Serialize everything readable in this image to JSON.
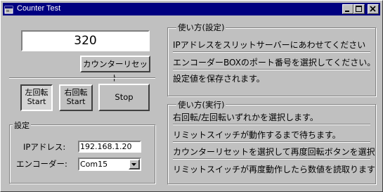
{
  "window": {
    "title": "Counter Test",
    "app_icon": "app-icon",
    "controls": {
      "minimize": "minimize-icon",
      "maximize": "maximize-icon",
      "close": "close-icon"
    }
  },
  "counter": {
    "value": "320"
  },
  "buttons": {
    "reset": "カウンターリセット",
    "left_top": "左回転",
    "left_bottom": "Start",
    "right_top": "右回転",
    "right_bottom": "Start",
    "stop": "Stop"
  },
  "settings": {
    "group_label": "設定",
    "ip_label": "IPアドレス:",
    "ip_value": "192.168.1.20",
    "encoder_label": "エンコーダー:",
    "encoder_value": "Com15",
    "dropdown_icon": "chevron-down-icon"
  },
  "usage_settings": {
    "title": "使い方(設定)",
    "lines": [
      "IPアドレスをスリットサーバーにあわせてください",
      "エンコーダーBOXのポート番号を選択してください。",
      "設定値を保存されます。"
    ]
  },
  "usage_run": {
    "title": "使い方(実行)",
    "lines": [
      "右回転/左回転いずれかを選択します。",
      "リミットスイッチが動作するまで待ちます。",
      "カウンターリセットを選択して再度回転ボタンを選択",
      "リミットスイッチが再度動作したら数値を読取ります"
    ]
  }
}
